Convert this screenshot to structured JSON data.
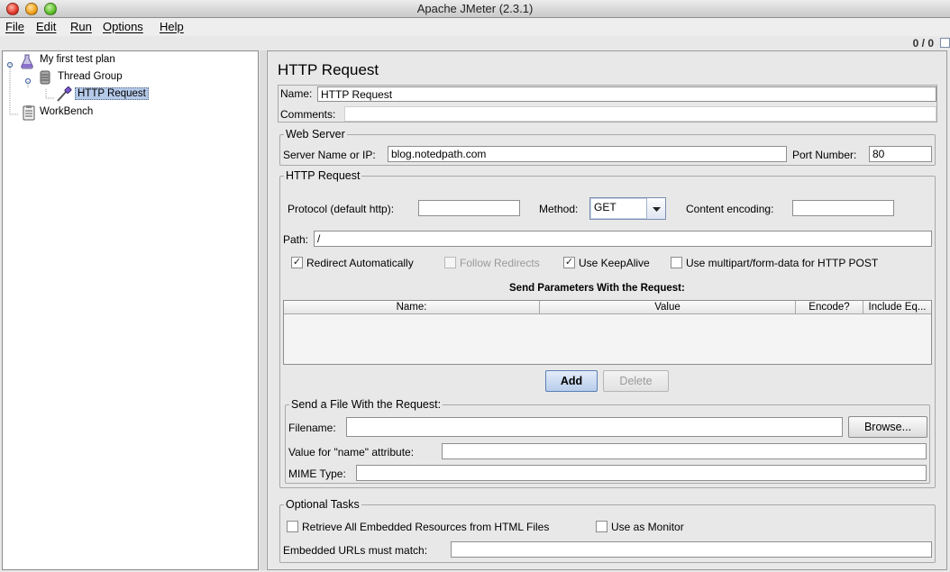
{
  "window": {
    "title": "Apache JMeter (2.3.1)"
  },
  "menu": [
    "File",
    "Edit",
    "Run",
    "Options",
    "Help"
  ],
  "status": {
    "counter": "0 / 0"
  },
  "tree": {
    "test_plan": "My first test plan",
    "thread_group": "Thread Group",
    "http_request": "HTTP Request",
    "workbench": "WorkBench"
  },
  "form": {
    "heading": "HTTP Request",
    "name_label": "Name:",
    "name_value": "HTTP Request",
    "comments_label": "Comments:",
    "comments_value": "",
    "web_server": {
      "legend": "Web Server",
      "server_label": "Server Name or IP:",
      "server_value": "blog.notedpath.com",
      "port_label": "Port Number:",
      "port_value": "80"
    },
    "http_request": {
      "legend": "HTTP Request",
      "protocol_label": "Protocol (default http):",
      "protocol_value": "",
      "method_label": "Method:",
      "method_value": "GET",
      "encoding_label": "Content encoding:",
      "encoding_value": "",
      "path_label": "Path:",
      "path_value": "/",
      "checks": {
        "redirect_auto": {
          "label": "Redirect Automatically",
          "checked": true
        },
        "follow_redirects": {
          "label": "Follow Redirects",
          "checked": false,
          "enabled": false
        },
        "keepalive": {
          "label": "Use KeepAlive",
          "checked": true
        },
        "multipart": {
          "label": "Use multipart/form-data for HTTP POST",
          "checked": false
        }
      },
      "params_title": "Send Parameters With the Request:",
      "columns": [
        "Name:",
        "Value",
        "Encode?",
        "Include Eq..."
      ],
      "add_label": "Add",
      "delete_label": "Delete"
    },
    "file": {
      "legend": "Send a File With the Request:",
      "filename_label": "Filename:",
      "filename_value": "",
      "browse_label": "Browse...",
      "name_attr_label": "Value for \"name\" attribute:",
      "name_attr_value": "",
      "mime_label": "MIME Type:",
      "mime_value": ""
    },
    "optional": {
      "legend": "Optional Tasks",
      "embedded_label": "Retrieve All Embedded Resources from HTML Files",
      "embedded_checked": false,
      "monitor_label": "Use as Monitor",
      "monitor_checked": false,
      "match_label": "Embedded URLs must match:",
      "match_value": ""
    }
  }
}
